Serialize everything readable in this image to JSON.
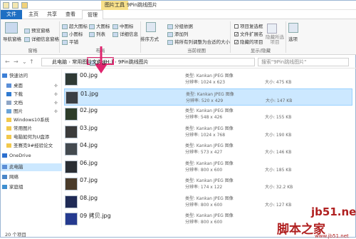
{
  "window": {
    "tools_tab": "图片工具",
    "title": "9Pin跳线图片"
  },
  "tabs": [
    "文件",
    "主页",
    "共享",
    "查看",
    "管理"
  ],
  "ribbon": {
    "nav_pane": "导航窗格",
    "preview_pane": "预览窗格",
    "details_pane": "详细信息窗格",
    "pane_group": "窗格",
    "extra_large": "超大图标",
    "large": "大图标",
    "medium": "中图标",
    "small": "小图标",
    "list": "列表",
    "details": "详细信息",
    "tiles": "平铺",
    "content": "内容",
    "layout_group": "布局",
    "sort_by": "排序方式",
    "group_by": "分组依据",
    "add_columns": "添加列",
    "size_columns": "将所有列调整为合适的大小",
    "current_view_group": "当前视图",
    "item_checkbox": "项目复选框",
    "file_ext": "文件扩展名",
    "hidden_items": "隐藏的项目",
    "hide_selected": "隐藏所选项目",
    "show_hide_group": "显示/隐藏",
    "options": "选项"
  },
  "address": {
    "path": [
      "此电脑",
      "常用图片文件 (H:)",
      "9Pin跳线图片"
    ],
    "search_placeholder": "搜索\"9Pin跳线图片\""
  },
  "sidebar": [
    {
      "label": "快速访问",
      "icon": "star-icon",
      "pinned": false,
      "selected": false
    },
    {
      "label": "桌面",
      "icon": "desktop-icon",
      "pinned": true,
      "selected": false
    },
    {
      "label": "下载",
      "icon": "download-icon",
      "pinned": true,
      "selected": false
    },
    {
      "label": "文档",
      "icon": "document-icon",
      "pinned": true,
      "selected": false
    },
    {
      "label": "图片",
      "icon": "picture-icon",
      "pinned": true,
      "selected": false
    },
    {
      "label": "Windows10系统",
      "icon": "folder-icon",
      "pinned": false,
      "selected": false
    },
    {
      "label": "常用图片",
      "icon": "folder-icon",
      "pinned": false,
      "selected": false
    },
    {
      "label": "电脑如何为U盘添",
      "icon": "folder-icon",
      "pinned": false,
      "selected": false
    },
    {
      "label": "圣赛克9#经验论文",
      "icon": "folder-icon",
      "pinned": false,
      "selected": false
    },
    {
      "label": "OneDrive",
      "icon": "cloud-icon",
      "pinned": false,
      "selected": false
    },
    {
      "label": "此电脑",
      "icon": "computer-icon",
      "pinned": false,
      "selected": true
    },
    {
      "label": "网络",
      "icon": "network-icon",
      "pinned": false,
      "selected": false
    },
    {
      "label": "家庭组",
      "icon": "homegroup-icon",
      "pinned": false,
      "selected": false
    }
  ],
  "files": [
    {
      "name": "00.jpg",
      "type": "类型: Kankan JPEG 图像",
      "dim": "分辨率: 1024 x 623",
      "size": "大小: 475 KB",
      "thumb": "#2f3a35",
      "selected": false
    },
    {
      "name": "01.jpg",
      "type": "类型: Kankan JPEG 图像",
      "dim": "分辨率: 520 x 429",
      "size": "大小: 147 KB",
      "thumb": "#3a3f44",
      "selected": true
    },
    {
      "name": "02.jpg",
      "type": "类型: Kankan JPEG 图像",
      "dim": "分辨率: 548 x 426",
      "size": "大小: 155 KB",
      "thumb": "#2e3d2a",
      "selected": false
    },
    {
      "name": "03.jpg",
      "type": "类型: Kankan JPEG 图像",
      "dim": "分辨率: 1024 x 768",
      "size": "大小: 190 KB",
      "thumb": "#3b3b3b",
      "selected": false
    },
    {
      "name": "04.jpg",
      "type": "类型: Kankan JPEG 图像",
      "dim": "分辨率: 573 x 427",
      "size": "大小: 146 KB",
      "thumb": "#444a4f",
      "selected": false
    },
    {
      "name": "06.jpg",
      "type": "类型: Kankan JPEG 图像",
      "dim": "分辨率: 800 x 600",
      "size": "大小: 185 KB",
      "thumb": "#2a2e33",
      "selected": false
    },
    {
      "name": "07.jpg",
      "type": "类型: Kankan JPEG 图像",
      "dim": "分辨率: 174 x 122",
      "size": "大小: 32.2 KB",
      "thumb": "#4a3b2a",
      "selected": false
    },
    {
      "name": "08.jpg",
      "type": "类型: Kankan JPEG 图像",
      "dim": "分辨率: 800 x 600",
      "size": "大小: 127 KB",
      "thumb": "#1f2a55",
      "selected": false
    },
    {
      "name": "09 拷贝.jpg",
      "type": "类型: Kankan JPEG 图像",
      "dim": "分辨率: 800 x 600",
      "size": "",
      "thumb": "#253a8f",
      "selected": false
    }
  ],
  "status": {
    "count": "20 个项目"
  },
  "watermark": {
    "site": "jb51.net",
    "brand": "脚本之家",
    "domain": "www.jb51.net"
  },
  "colors": {
    "accent": "#1e6fc3",
    "highlight": "#e0246e",
    "selection": "#cce8ff"
  }
}
